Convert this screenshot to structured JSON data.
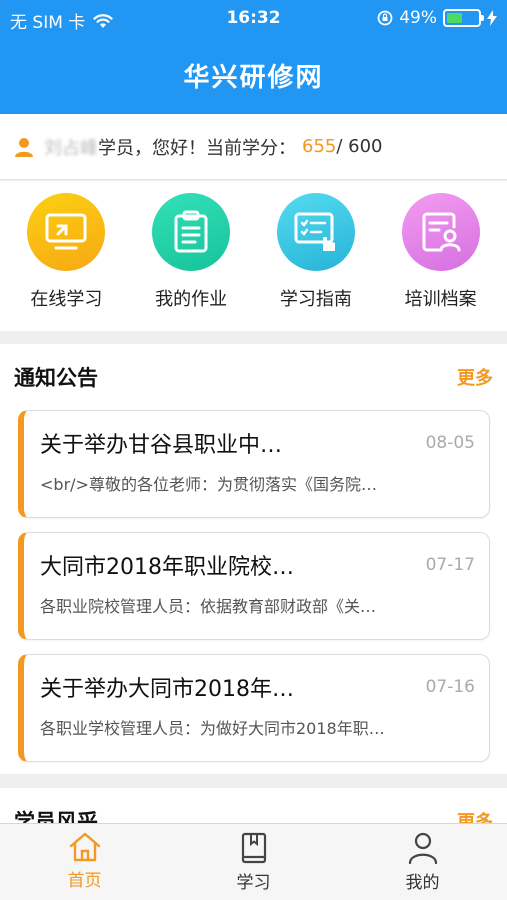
{
  "status": {
    "carrier": "无 SIM 卡",
    "time": "16:32",
    "battery": "49%",
    "battery_level": 0.49
  },
  "nav": {
    "title": "华兴研修网"
  },
  "user": {
    "name": "刘占峰",
    "greeting_suffix": "学员，您好！当前学分：",
    "score": "655",
    "score_total": "/ 600"
  },
  "shortcuts": [
    {
      "label": "在线学习",
      "color_from": "#fcd012",
      "color_to": "#f7a814",
      "icon": "monitor-icon"
    },
    {
      "label": "我的作业",
      "color_from": "#35e0b8",
      "color_to": "#15c39a",
      "icon": "clipboard-icon"
    },
    {
      "label": "学习指南",
      "color_from": "#55dcf0",
      "color_to": "#26b3d8",
      "icon": "guide-icon"
    },
    {
      "label": "培训档案",
      "color_from": "#f39cf2",
      "color_to": "#d66fe0",
      "icon": "profile-icon"
    }
  ],
  "notice": {
    "title": "通知公告",
    "more": "更多",
    "items": [
      {
        "title": "关于举办甘谷县职业中…",
        "date": "08-05",
        "summary": "<br/>尊敬的各位老师：为贯彻落实《国务院…"
      },
      {
        "title": "大同市2018年职业院校…",
        "date": "07-17",
        "summary": "各职业院校管理人员：依据教育部财政部《关…"
      },
      {
        "title": "关于举办大同市2018年…",
        "date": "07-16",
        "summary": "各职业学校管理人员：为做好大同市2018年职…"
      }
    ]
  },
  "students": {
    "title": "学员风采",
    "more": "更多"
  },
  "tabs": [
    {
      "label": "首页",
      "icon": "home-icon"
    },
    {
      "label": "学习",
      "icon": "book-icon"
    },
    {
      "label": "我的",
      "icon": "person-icon"
    }
  ],
  "colors": {
    "primary": "#2196f3",
    "accent": "#f39820"
  }
}
